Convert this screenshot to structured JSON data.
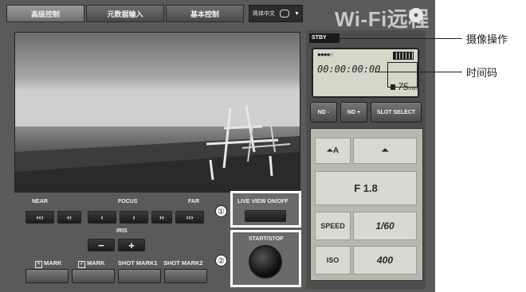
{
  "tabs": [
    "高级控制",
    "元数据输入",
    "基本控制"
  ],
  "language": {
    "label": "简体中文",
    "arrow": "▼"
  },
  "app_title": "Wi-Fi远程",
  "focus": {
    "near_label": "NEAR",
    "focus_label": "FOCUS",
    "far_label": "FAR",
    "buttons": [
      "‹‹‹",
      "‹‹",
      "‹",
      "›",
      "››",
      "›››"
    ]
  },
  "iris": {
    "label": "IRIS",
    "minus": "−",
    "plus": "+"
  },
  "marks": {
    "x_mark": "MARK",
    "check_mark": "MARK",
    "shot_mark1": "SHOT MARK1",
    "shot_mark2": "SHOT MARK2"
  },
  "live_view": {
    "number": "①",
    "label": "LIVE VIEW ON/OFF"
  },
  "start_stop": {
    "number": "②",
    "label": "START/STOP"
  },
  "status": {
    "mode": "STBY",
    "timecode": "00:00:00:00",
    "remaining": "75",
    "remaining_unit": "min",
    "dots": "●●●●○"
  },
  "lcd_buttons": [
    "ND -",
    "ND +",
    "SLOT SELECT"
  ],
  "camera": {
    "aperture": "F 1.8",
    "speed_label": "SPEED",
    "speed_value": "1/60",
    "iso_label": "ISO",
    "iso_value": "400"
  },
  "annotations": {
    "camera_operation": "摄像操作",
    "timecode": "时间码"
  },
  "colors": {
    "frame": "#5a5a5a",
    "lcd": "#d6d7c9",
    "highlight": "#ffffff"
  }
}
